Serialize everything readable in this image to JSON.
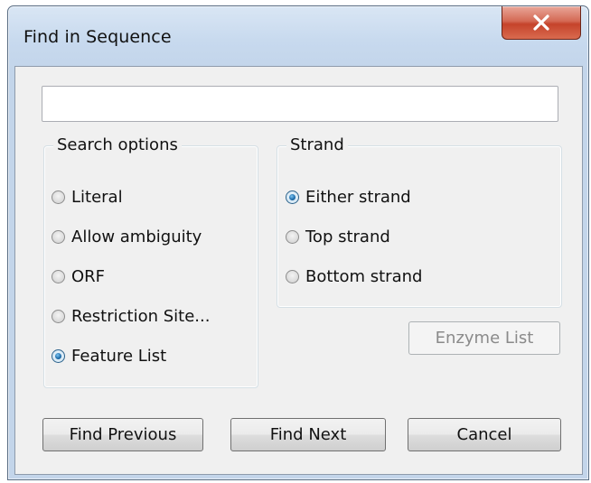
{
  "window": {
    "title": "Find in Sequence"
  },
  "search": {
    "value": "",
    "placeholder": ""
  },
  "search_options": {
    "legend": "Search options",
    "items": [
      {
        "label": "Literal",
        "checked": false
      },
      {
        "label": "Allow ambiguity",
        "checked": false
      },
      {
        "label": "ORF",
        "checked": false
      },
      {
        "label": "Restriction Site...",
        "checked": false
      },
      {
        "label": "Feature List",
        "checked": true
      }
    ]
  },
  "strand": {
    "legend": "Strand",
    "items": [
      {
        "label": "Either strand",
        "checked": true
      },
      {
        "label": "Top strand",
        "checked": false
      },
      {
        "label": "Bottom strand",
        "checked": false
      }
    ]
  },
  "buttons": {
    "enzyme_list": "Enzyme List",
    "find_previous": "Find Previous",
    "find_next": "Find Next",
    "cancel": "Cancel"
  },
  "colors": {
    "close_button": "#c5432b",
    "radio_selected": "#1c6aa8",
    "dialog_background": "#f0f0f0"
  },
  "icons": {
    "close": "close-icon"
  }
}
